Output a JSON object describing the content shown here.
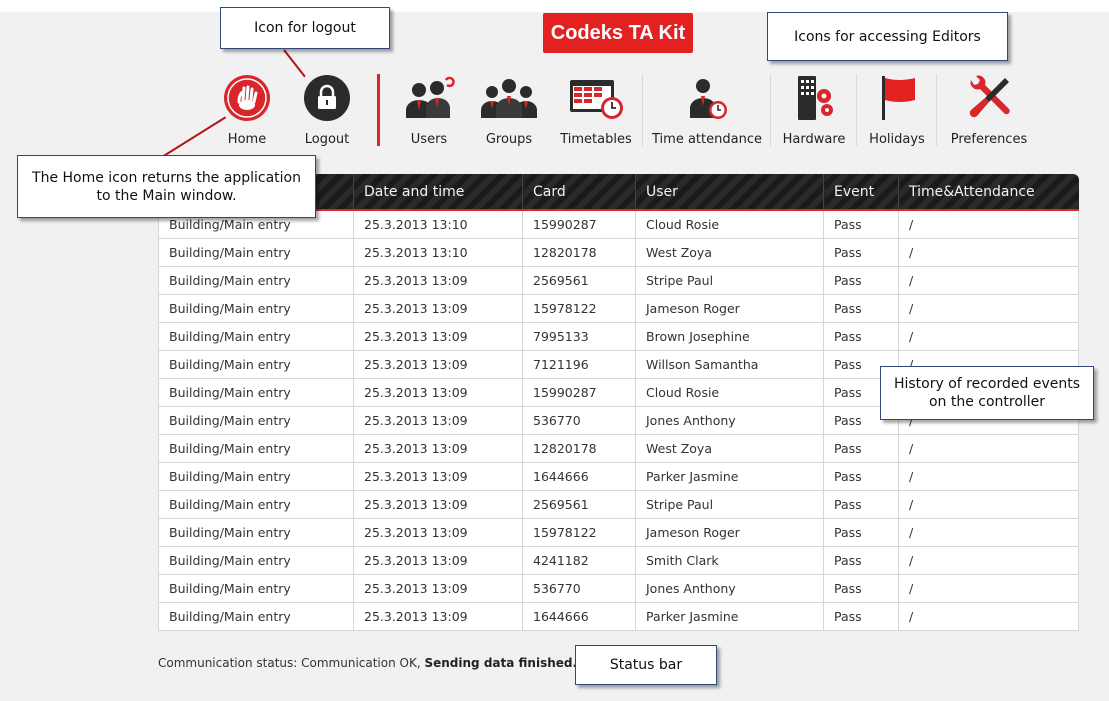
{
  "app": {
    "title": "Codeks TA Kit"
  },
  "toolbar": {
    "items": [
      {
        "label": "Home",
        "icon": "hand-icon"
      },
      {
        "label": "Logout",
        "icon": "lock-icon"
      },
      {
        "label": "Users",
        "icon": "users-icon"
      },
      {
        "label": "Groups",
        "icon": "groups-icon"
      },
      {
        "label": "Timetables",
        "icon": "timetable-icon"
      },
      {
        "label": "Time attendance",
        "icon": "time-attendance-icon"
      },
      {
        "label": "Hardware",
        "icon": "hardware-icon"
      },
      {
        "label": "Holidays",
        "icon": "flag-icon"
      },
      {
        "label": "Preferences",
        "icon": "tools-icon"
      }
    ]
  },
  "callouts": {
    "logout": "Icon for logout",
    "editors": "Icons for accessing Editors",
    "home": "The Home icon returns the application to the Main window.",
    "history": "History of recorded events on the controller",
    "statusbar": "Status bar"
  },
  "table": {
    "columns": [
      "",
      "Date and time",
      "Card",
      "User",
      "Event",
      "Time&Attendance"
    ],
    "rows": [
      [
        "Building/Main entry",
        "25.3.2013 13:10",
        "15990287",
        "Cloud Rosie",
        "Pass",
        "/"
      ],
      [
        "Building/Main entry",
        "25.3.2013 13:10",
        "12820178",
        "West Zoya",
        "Pass",
        "/"
      ],
      [
        "Building/Main entry",
        "25.3.2013 13:09",
        "2569561",
        "Stripe Paul",
        "Pass",
        "/"
      ],
      [
        "Building/Main entry",
        "25.3.2013 13:09",
        "15978122",
        "Jameson Roger",
        "Pass",
        "/"
      ],
      [
        "Building/Main entry",
        "25.3.2013 13:09",
        "7995133",
        "Brown Josephine",
        "Pass",
        "/"
      ],
      [
        "Building/Main entry",
        "25.3.2013 13:09",
        "7121196",
        "Willson Samantha",
        "Pass",
        "/"
      ],
      [
        "Building/Main entry",
        "25.3.2013 13:09",
        "15990287",
        "Cloud Rosie",
        "Pass",
        "/"
      ],
      [
        "Building/Main entry",
        "25.3.2013 13:09",
        "536770",
        "Jones Anthony",
        "Pass",
        "/"
      ],
      [
        "Building/Main entry",
        "25.3.2013 13:09",
        "12820178",
        "West Zoya",
        "Pass",
        "/"
      ],
      [
        "Building/Main entry",
        "25.3.2013 13:09",
        "1644666",
        "Parker Jasmine",
        "Pass",
        "/"
      ],
      [
        "Building/Main entry",
        "25.3.2013 13:09",
        "2569561",
        "Stripe Paul",
        "Pass",
        "/"
      ],
      [
        "Building/Main entry",
        "25.3.2013 13:09",
        "15978122",
        "Jameson Roger",
        "Pass",
        "/"
      ],
      [
        "Building/Main entry",
        "25.3.2013 13:09",
        "4241182",
        "Smith Clark",
        "Pass",
        "/"
      ],
      [
        "Building/Main entry",
        "25.3.2013 13:09",
        "536770",
        "Jones Anthony",
        "Pass",
        "/"
      ],
      [
        "Building/Main entry",
        "25.3.2013 13:09",
        "1644666",
        "Parker Jasmine",
        "Pass",
        "/"
      ]
    ]
  },
  "status": {
    "prefix": "Communication status: Communication OK,",
    "bold": "Sending data finished."
  },
  "colors": {
    "accent": "#e32121",
    "header_dark": "#1e1e1e"
  }
}
